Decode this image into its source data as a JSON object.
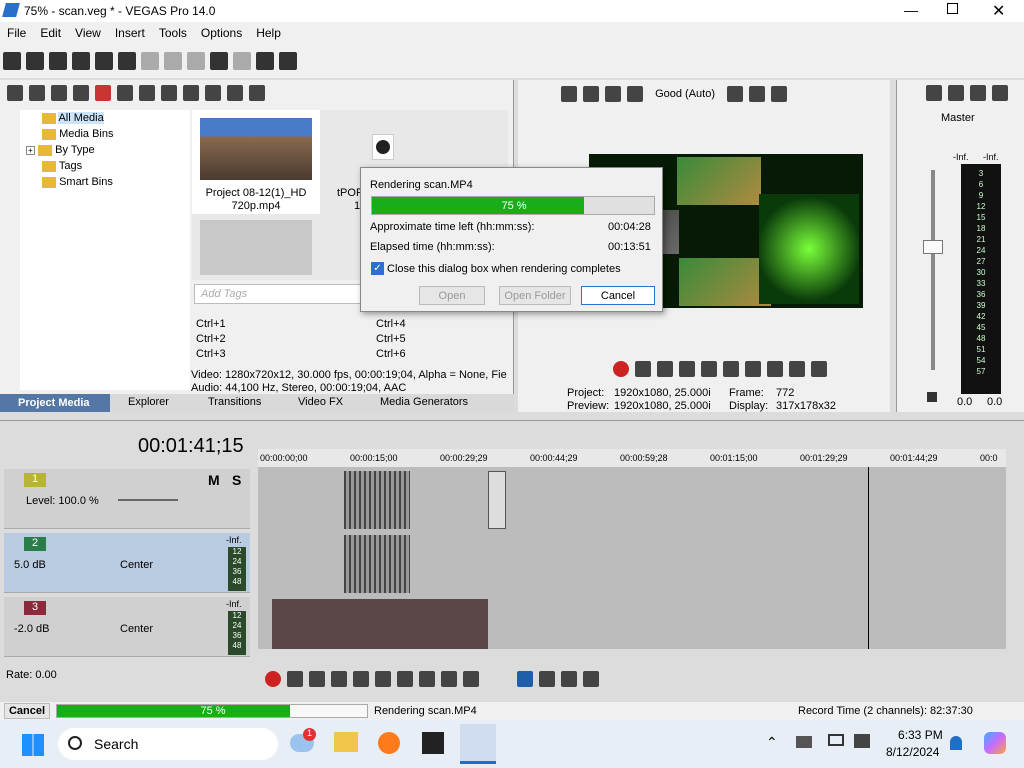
{
  "window": {
    "title": "75% - scan.veg * - VEGAS Pro 14.0"
  },
  "menu": [
    "File",
    "Edit",
    "View",
    "Insert",
    "Tools",
    "Options",
    "Help"
  ],
  "media_tree": {
    "items": [
      "All Media",
      "Media Bins",
      "By Type",
      "Tags",
      "Smart Bins"
    ]
  },
  "media": {
    "file1_line1": "Project 08-12(1)_HD",
    "file1_line2": "720p.mp4",
    "file2_partial": "tPOR",
    "file2_sub": "1",
    "search_placeholder": "Add Tags",
    "info_line1": "Video: 1280x720x12, 30.000 fps, 00:00:19;04, Alpha = None, Fie",
    "info_line2": "Audio: 44,100 Hz, Stereo, 00:00:19;04, AAC"
  },
  "shortcuts": [
    "Ctrl+1",
    "Ctrl+2",
    "Ctrl+3",
    "Ctrl+4",
    "Ctrl+5",
    "Ctrl+6"
  ],
  "tabs": [
    "Project Media",
    "Explorer",
    "Transitions",
    "Video FX",
    "Media Generators"
  ],
  "preview": {
    "quality": "Good (Auto)",
    "project_label": "Project:",
    "project_val": "1920x1080, 25.000i",
    "preview_label": "Preview:",
    "preview_val": "1920x1080, 25.000i",
    "frame_label": "Frame:",
    "frame_val": "772",
    "display_label": "Display:",
    "display_val": "317x178x32"
  },
  "master": {
    "label": "Master",
    "inf": "-Inf.",
    "scale": [
      "3",
      "6",
      "9",
      "12",
      "15",
      "18",
      "21",
      "24",
      "27",
      "30",
      "33",
      "36",
      "39",
      "42",
      "45",
      "48",
      "51",
      "54",
      "57"
    ],
    "bottom_left": "0.0",
    "bottom_right": "0.0"
  },
  "dialog": {
    "title": "Rendering scan.MP4",
    "progress_text": "75 %",
    "progress": 0.75,
    "time_left_label": "Approximate time left (hh:mm:ss):",
    "time_left": "00:04:28",
    "elapsed_label": "Elapsed time (hh:mm:ss):",
    "elapsed": "00:13:51",
    "checkbox_label": "Close this dialog box when rendering completes",
    "open": "Open",
    "open_folder": "Open Folder",
    "cancel": "Cancel"
  },
  "timeline": {
    "timecode": "00:01:41;15",
    "ruler": [
      "00:00:00;00",
      "00:00:15;00",
      "00:00:29;29",
      "00:00:44;29",
      "00:00:59;28",
      "00:01:15;00",
      "00:01:29;29",
      "00:01:44;29",
      "00:0"
    ]
  },
  "tracks": [
    {
      "num": "1",
      "label": "Level: 100.0 %"
    },
    {
      "num": "2",
      "vol": "5.0 dB",
      "pan": "Center",
      "inf": "-Inf."
    },
    {
      "num": "3",
      "vol": "-2.0 dB",
      "pan": "Center",
      "inf": "-Inf."
    }
  ],
  "meter_small": [
    "12",
    "24",
    "36",
    "48"
  ],
  "rate": "Rate: 0.00",
  "status": {
    "cancel": "Cancel",
    "progress_text": "75 %",
    "progress": 0.75,
    "rendering": "Rendering scan.MP4",
    "record_time": "Record Time (2 channels): 82:37:30"
  },
  "taskbar": {
    "search": "Search",
    "time": "6:33 PM",
    "date": "8/12/2024",
    "badge": "1"
  }
}
